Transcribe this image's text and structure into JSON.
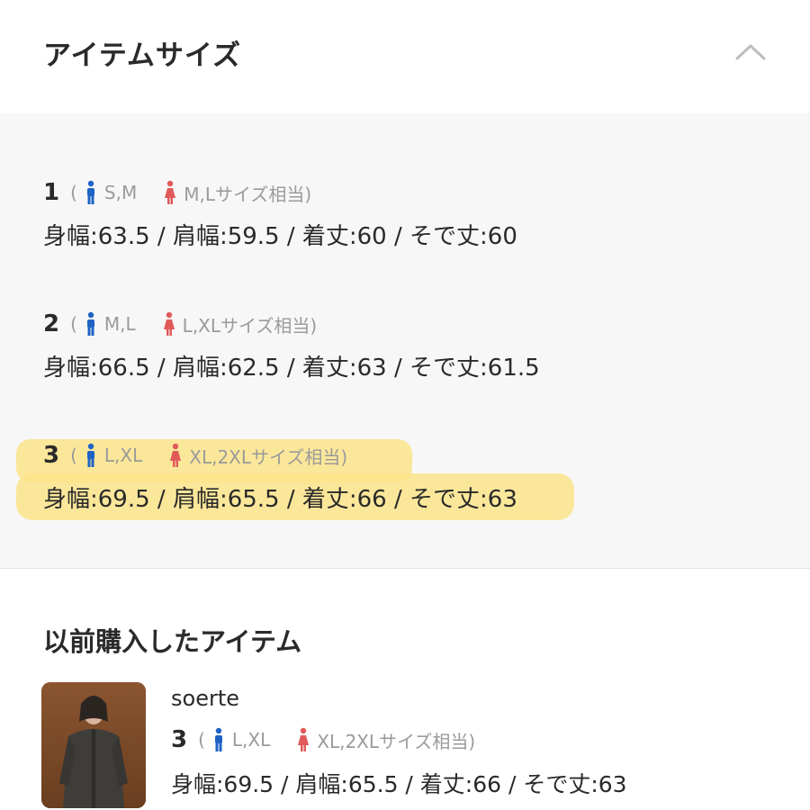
{
  "header": {
    "title": "アイテムサイズ",
    "collapse_icon": "chevron-up-icon"
  },
  "colors": {
    "men_icon": "#1e63c4",
    "women_icon": "#e05a5a",
    "highlight": "#fbe48a"
  },
  "size_entries": [
    {
      "number": "1",
      "open_paren": "(",
      "men": "S,M",
      "women": "M,Lサイズ相当)",
      "measurements": "身幅:63.5 / 肩幅:59.5 / 着丈:60 / そで丈:60"
    },
    {
      "number": "2",
      "open_paren": "(",
      "men": "M,L",
      "women": "L,XLサイズ相当)",
      "measurements": "身幅:66.5 / 肩幅:62.5 / 着丈:63 / そで丈:61.5"
    },
    {
      "number": "3",
      "open_paren": "(",
      "men": "L,XL",
      "women": "XL,2XLサイズ相当)",
      "measurements": "身幅:69.5 / 肩幅:65.5 / 着丈:66 / そで丈:63"
    }
  ],
  "history": {
    "title": "以前購入したアイテム",
    "item": {
      "brand": "soerte",
      "number": "3",
      "open_paren": "(",
      "men": "L,XL",
      "women": "XL,2XLサイズ相当)",
      "measurements": "身幅:69.5 / 肩幅:65.5 / 着丈:66 / そで丈:63"
    }
  }
}
